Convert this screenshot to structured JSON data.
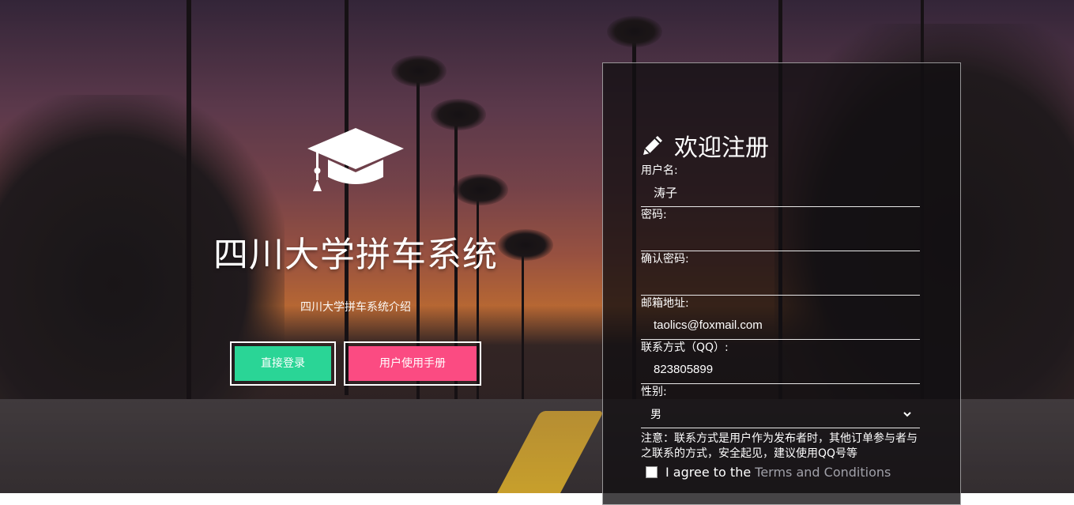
{
  "hero": {
    "title": "四川大学拼车系统",
    "subtitle": "四川大学拼车系统介绍",
    "login_button": "直接登录",
    "manual_button": "用户使用手册"
  },
  "register": {
    "title": "欢迎注册",
    "fields": {
      "username": {
        "label": "用户名:",
        "value": "涛子"
      },
      "password": {
        "label": "密码:",
        "value": ""
      },
      "confirm_password": {
        "label": "确认密码:",
        "value": ""
      },
      "email": {
        "label": "邮箱地址:",
        "value": "taolics@foxmail.com"
      },
      "qq": {
        "label": "联系方式（QQ）:",
        "value": "823805899"
      },
      "gender": {
        "label": "性别:",
        "value": "男"
      }
    },
    "note": "注意：联系方式是用户作为发布者时，其他订单参与者与之联系的方式，安全起见，建议使用QQ号等",
    "agree_text": "I agree to the",
    "terms_link": "Terms and Conditions"
  },
  "colors": {
    "login_button": "#2ad596",
    "manual_button": "#fb4b82"
  }
}
